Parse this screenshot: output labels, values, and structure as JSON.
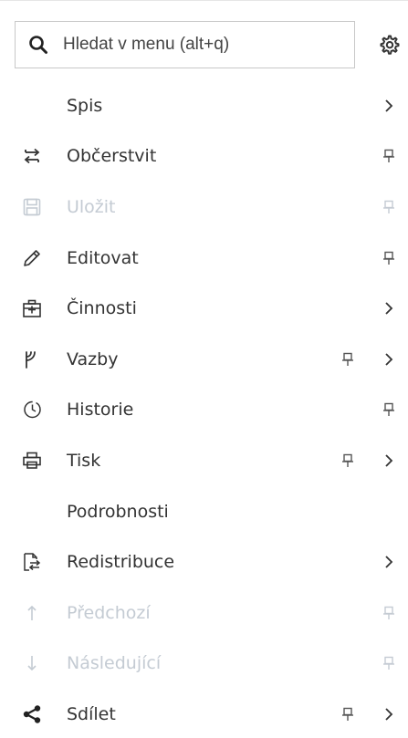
{
  "search": {
    "placeholder": "Hledat v menu (alt+q)",
    "icon": "search-icon"
  },
  "settings": {
    "icon": "gear-icon"
  },
  "colors": {
    "text": "#333333",
    "disabled_text": "#c4cbd3",
    "border": "#c8c8c8",
    "icon": "#333333"
  },
  "menu": {
    "items": [
      {
        "label": "Spis",
        "icon": null,
        "pin": false,
        "submenu": true,
        "disabled": false
      },
      {
        "label": "Občerstvit",
        "icon": "refresh-icon",
        "pin": true,
        "submenu": false,
        "disabled": false
      },
      {
        "label": "Uložit",
        "icon": "save-icon",
        "pin": true,
        "submenu": false,
        "disabled": true
      },
      {
        "label": "Editovat",
        "icon": "pencil-icon",
        "pin": true,
        "submenu": false,
        "disabled": false
      },
      {
        "label": "Činnosti",
        "icon": "briefcase-plus-icon",
        "pin": false,
        "submenu": true,
        "disabled": false
      },
      {
        "label": "Vazby",
        "icon": "branch-icon",
        "pin": true,
        "submenu": true,
        "disabled": false
      },
      {
        "label": "Historie",
        "icon": "history-icon",
        "pin": true,
        "submenu": false,
        "disabled": false
      },
      {
        "label": "Tisk",
        "icon": "printer-icon",
        "pin": true,
        "submenu": true,
        "disabled": false
      },
      {
        "label": "Podrobnosti",
        "icon": null,
        "pin": false,
        "submenu": false,
        "disabled": false
      },
      {
        "label": "Redistribuce",
        "icon": "file-transfer-icon",
        "pin": false,
        "submenu": true,
        "disabled": false
      },
      {
        "label": "Předchozí",
        "icon": "arrow-up-icon",
        "pin": true,
        "submenu": false,
        "disabled": true
      },
      {
        "label": "Následující",
        "icon": "arrow-down-icon",
        "pin": true,
        "submenu": false,
        "disabled": true
      },
      {
        "label": "Sdílet",
        "icon": "share-icon",
        "pin": true,
        "submenu": true,
        "disabled": false
      }
    ]
  }
}
